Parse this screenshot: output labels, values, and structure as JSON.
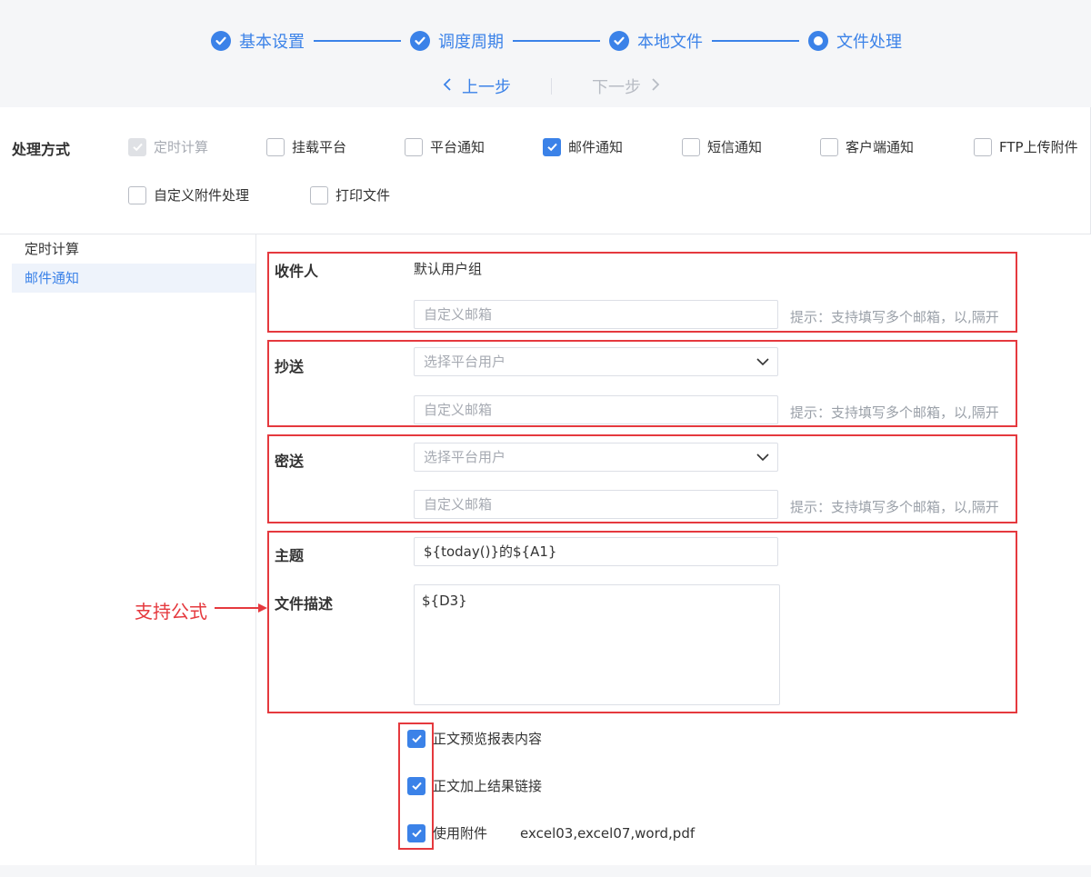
{
  "colors": {
    "accent": "#3b82e8",
    "annotation": "#e5393e",
    "muted": "#a6aab2"
  },
  "steps": [
    {
      "label": "基本设置",
      "state": "done"
    },
    {
      "label": "调度周期",
      "state": "done"
    },
    {
      "label": "本地文件",
      "state": "done"
    },
    {
      "label": "文件处理",
      "state": "current"
    }
  ],
  "nav": {
    "prev": "上一步",
    "next": "下一步"
  },
  "mode": {
    "label": "处理方式",
    "options": [
      {
        "label": "定时计算",
        "checked": true,
        "disabled": true
      },
      {
        "label": "挂载平台",
        "checked": false
      },
      {
        "label": "平台通知",
        "checked": false
      },
      {
        "label": "邮件通知",
        "checked": true
      },
      {
        "label": "短信通知",
        "checked": false
      },
      {
        "label": "客户端通知",
        "checked": false
      },
      {
        "label": "FTP上传附件",
        "checked": false
      },
      {
        "label": "自定义附件处理",
        "checked": false
      },
      {
        "label": "打印文件",
        "checked": false
      }
    ]
  },
  "sidebar": {
    "items": [
      {
        "label": "定时计算",
        "active": false
      },
      {
        "label": "邮件通知",
        "active": true
      }
    ]
  },
  "form": {
    "recipient": {
      "label": "收件人",
      "value": "默认用户组",
      "email_placeholder": "自定义邮箱",
      "hint": "提示：支持填写多个邮箱，以,隔开"
    },
    "cc": {
      "label": "抄送",
      "select_placeholder": "选择平台用户",
      "email_placeholder": "自定义邮箱",
      "hint": "提示：支持填写多个邮箱，以,隔开"
    },
    "bcc": {
      "label": "密送",
      "select_placeholder": "选择平台用户",
      "email_placeholder": "自定义邮箱",
      "hint": "提示：支持填写多个邮箱，以,隔开"
    },
    "subject": {
      "label": "主题",
      "value": "${today()}的${A1}"
    },
    "description": {
      "label": "文件描述",
      "value": "${D3}"
    },
    "options": [
      {
        "label": "正文预览报表内容",
        "checked": true
      },
      {
        "label": "正文加上结果链接",
        "checked": true
      },
      {
        "label": "使用附件",
        "checked": true,
        "extra": "excel03,excel07,word,pdf"
      }
    ]
  },
  "annotation": {
    "text": "支持公式"
  }
}
